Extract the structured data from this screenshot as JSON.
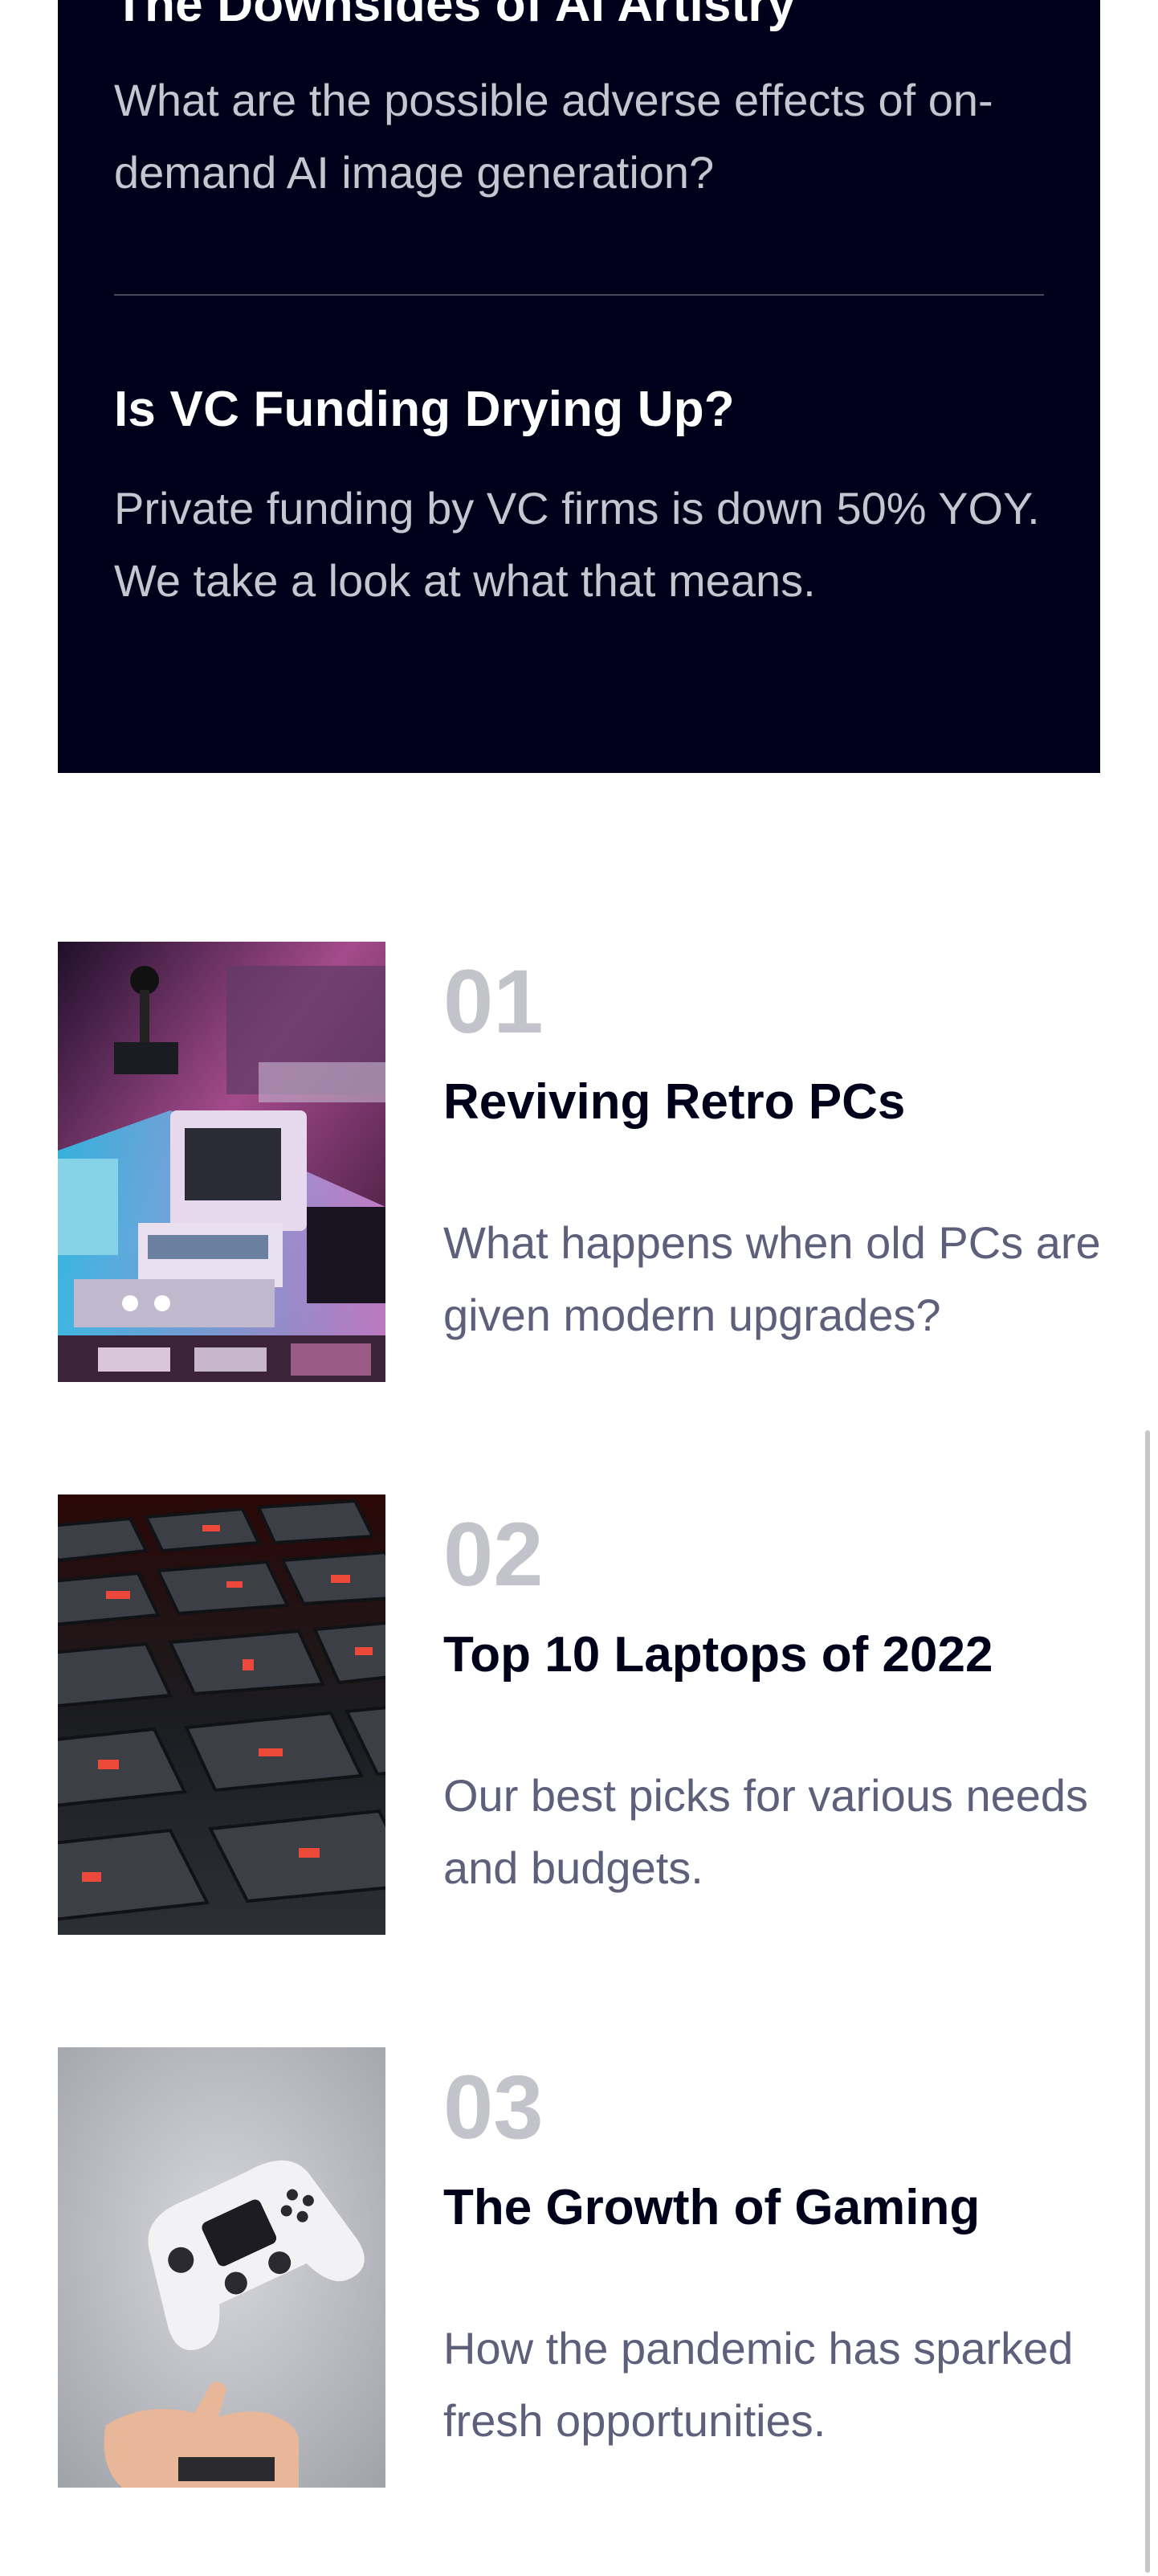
{
  "featured": [
    {
      "title": "The Downsides of AI Artistry",
      "description": "What are the possible adverse effects of on-demand AI image generation?"
    },
    {
      "title": "Is VC Funding Drying Up?",
      "description": "Private funding by VC firms is down 50% YOY. We take a look at what that means."
    }
  ],
  "articles": [
    {
      "number": "01",
      "title": "Reviving Retro PCs",
      "description": "What happens when old PCs are given modern upgrades?",
      "image_icon": "retro-pc-image"
    },
    {
      "number": "02",
      "title": "Top 10 Laptops of 2022",
      "description": "Our best picks for various needs and budgets.",
      "image_icon": "laptop-keyboard-image"
    },
    {
      "number": "03",
      "title": "The Growth of Gaming",
      "description": "How the pandemic has sparked fresh opportunities.",
      "image_icon": "game-controller-image"
    }
  ],
  "colors": {
    "panel_bg": "#00001a",
    "number_gray": "#c3c3cb",
    "title_dark": "#00001a",
    "desc_gray": "#5e5f7a"
  }
}
